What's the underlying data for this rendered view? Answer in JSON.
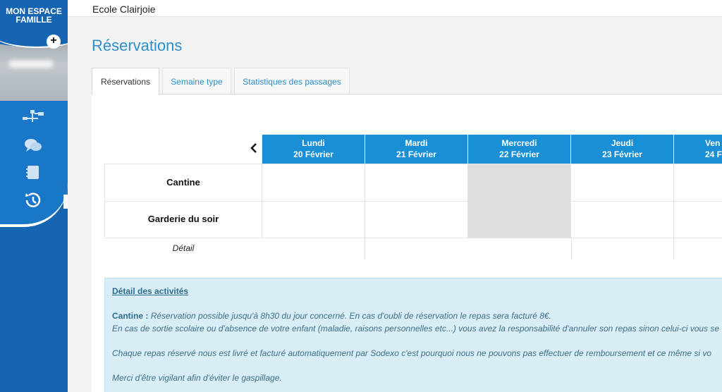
{
  "sidebar": {
    "brand_line1": "MON ESPACE",
    "brand_line2": "FAMILLE",
    "plus_label": "+",
    "nav": [
      {
        "icon": "flow-icon"
      },
      {
        "icon": "chat-icon"
      },
      {
        "icon": "notebook-icon"
      },
      {
        "icon": "history-icon"
      }
    ]
  },
  "header": {
    "school_name": "Ecole Clairjoie"
  },
  "page": {
    "title": "Réservations"
  },
  "tabs": [
    {
      "label": "Réservations",
      "active": true
    },
    {
      "label": "Semaine type",
      "active": false
    },
    {
      "label": "Statistiques des passages",
      "active": false
    }
  ],
  "calendar": {
    "prev_icon": "‹",
    "days": [
      {
        "name": "Lundi",
        "date": "20 Février",
        "closed": false
      },
      {
        "name": "Mardi",
        "date": "21 Février",
        "closed": false
      },
      {
        "name": "Mercredi",
        "date": "22 Février",
        "closed": true
      },
      {
        "name": "Jeudi",
        "date": "23 Février",
        "closed": false
      },
      {
        "name": "Ven",
        "date": "24 F",
        "closed": false
      }
    ],
    "rows": [
      {
        "label": "Cantine"
      },
      {
        "label": "Garderie du soir"
      }
    ],
    "detail_label": "Détail"
  },
  "info": {
    "heading": "Détail des activités",
    "cantine_title": "Cantine",
    "cantine_sep": " : ",
    "line1": "Réservation possible jusqu'à 8h30 du jour concerné. En cas d'oubli de réservation le repas sera facturé 8€.",
    "line2": "En cas de sortie scolaire ou d'absence de votre enfant (maladie, raisons personnelles etc...) vous avez la responsabilité d'annuler son repas sinon celui-ci vous se",
    "line3": "Chaque repas réservé nous est livré et facturé automatiquement par Sodexo c'est pourquoi nous ne pouvons pas effectuer de remboursement et ce même si vo",
    "line4": "Merci d'être vigilant afin d'éviter le gaspillage."
  }
}
